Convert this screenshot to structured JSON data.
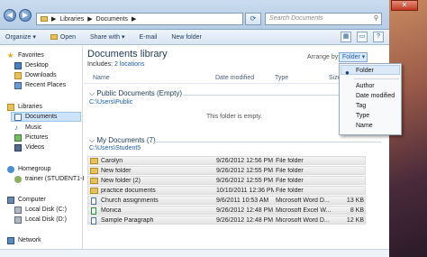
{
  "address": {
    "segments": [
      "▶",
      "Libraries",
      "▶",
      "Documents",
      "▶"
    ],
    "search_placeholder": "Search Documents"
  },
  "toolbar": {
    "organize": "Organize ▾",
    "open": "Open",
    "share_with": "Share with ▾",
    "email": "E-mail",
    "new_folder": "New folder"
  },
  "nav": {
    "favorites": "Favorites",
    "desktop": "Desktop",
    "downloads": "Downloads",
    "recent_places": "Recent Places",
    "libraries": "Libraries",
    "documents": "Documents",
    "music": "Music",
    "pictures": "Pictures",
    "videos": "Videos",
    "homegroup": "Homegroup",
    "trainer": "trainer (STUDENT1-I",
    "computer": "Computer",
    "local_c": "Local Disk (C:)",
    "local_d": "Local Disk (D:)",
    "network": "Network"
  },
  "library": {
    "title": "Documents library",
    "includes_label": "Includes:",
    "locations_link": "2 locations",
    "arrange_by": "Arrange by:",
    "arrange_value": "Folder ▾"
  },
  "columns": {
    "name": "Name",
    "date_modified": "Date modified",
    "type": "Type",
    "size": "Size"
  },
  "groups": {
    "public_title": "Public Documents (Empty)",
    "public_path": "C:\\Users\\Public",
    "empty_message": "This folder is empty.",
    "my_title": "My Documents (7)",
    "my_path": "C:\\Users\\Student5"
  },
  "files": [
    {
      "name": "Carolyn",
      "date": "9/26/2012 12:56 PM",
      "type": "File folder",
      "size": "",
      "kind": "folder"
    },
    {
      "name": "New folder",
      "date": "9/26/2012 12:55 PM",
      "type": "File folder",
      "size": "",
      "kind": "folder"
    },
    {
      "name": "New folder (2)",
      "date": "9/26/2012 12:55 PM",
      "type": "File folder",
      "size": "",
      "kind": "folder"
    },
    {
      "name": "practice documents",
      "date": "10/10/2011 12:36 PM",
      "type": "File folder",
      "size": "",
      "kind": "folder"
    },
    {
      "name": "Church assignments",
      "date": "9/6/2011 10:53 AM",
      "type": "Microsoft Word D...",
      "size": "13 KB",
      "kind": "doc"
    },
    {
      "name": "Monica",
      "date": "9/26/2012 12:48 PM",
      "type": "Microsoft Excel W...",
      "size": "8 KB",
      "kind": "xls"
    },
    {
      "name": "Sample Paragraph",
      "date": "9/26/2012 12:48 PM",
      "type": "Microsoft Word D...",
      "size": "12 KB",
      "kind": "doc"
    }
  ],
  "menu": {
    "items": [
      "Folder",
      "Author",
      "Date modified",
      "Tag",
      "Type",
      "Name"
    ],
    "selected_marker": "●"
  },
  "colors": {
    "accent": "#1a5fb4",
    "selection": "#cde3f8"
  }
}
